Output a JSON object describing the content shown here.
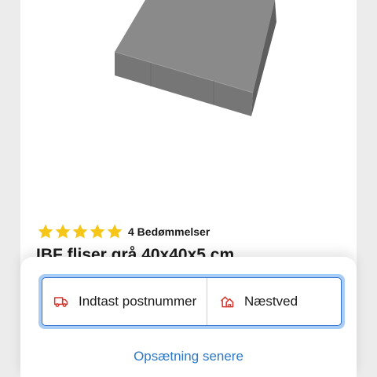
{
  "product": {
    "title": "IBF fliser grå 40x40x5 cm",
    "image_icon": "grey-concrete-tile",
    "rating": {
      "stars_filled": 5,
      "stars_total": 5,
      "count_label": "4 Bedømmelser"
    }
  },
  "location_selector": {
    "postal_label": "Indtast postnummer",
    "postal_icon": "delivery-truck-icon",
    "store_label": "Næstved",
    "store_icon": "store-icon",
    "setup_later_label": "Opsætning senere"
  },
  "colors": {
    "star": "#f5c518",
    "accent_blue": "#2d79c9",
    "focus_ring": "#a9cdf4",
    "icon_red": "#d9342b"
  }
}
